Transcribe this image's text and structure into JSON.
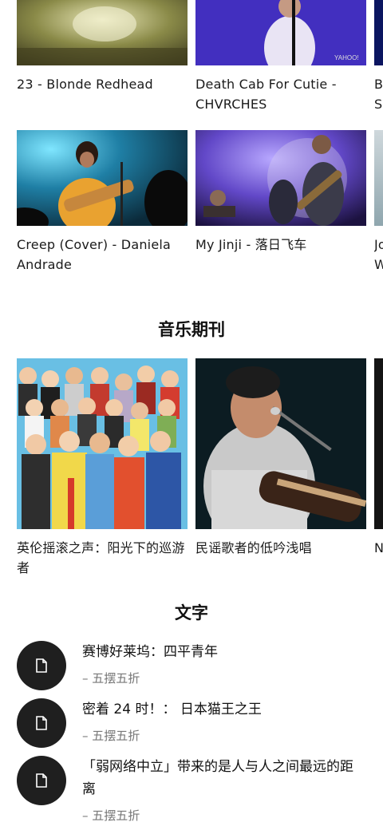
{
  "videos": {
    "row1": [
      {
        "caption": "23 - Blonde Redhead"
      },
      {
        "caption": "Death Cab For Cutie - CHVRCHES"
      },
      {
        "caption": "B S"
      }
    ],
    "row2": [
      {
        "caption": "Creep (Cover) - Daniela Andrade"
      },
      {
        "caption": "My Jinji - 落日飞车"
      },
      {
        "caption": "Jo W"
      }
    ],
    "watermark": "YAHOO!"
  },
  "periodicals": {
    "title": "音乐期刊",
    "items": [
      {
        "caption": "英伦摇滚之声：阳光下的巡游者"
      },
      {
        "caption": "民谣歌者的低吟浅唱"
      },
      {
        "caption": "N"
      }
    ]
  },
  "text_section": {
    "title": "文字",
    "icon": "document-icon",
    "items": [
      {
        "title": "赛博好莱坞：四平青年",
        "subtitle": "– 五摆五折"
      },
      {
        "title": "密着 24 时！： 日本猫王之王",
        "subtitle": "– 五摆五折"
      },
      {
        "title": "「弱网络中立」带来的是人与人之间最远的距离",
        "subtitle": "– 五摆五折"
      }
    ]
  }
}
